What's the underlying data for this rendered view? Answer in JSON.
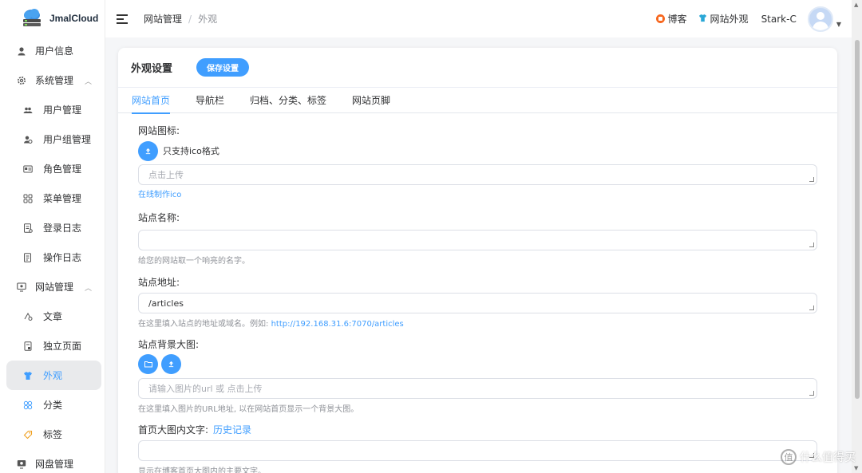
{
  "app": {
    "name": "JmalCloud"
  },
  "sidebar": {
    "items": [
      {
        "label": "用户信息",
        "level": "top",
        "icon": "user-icon"
      },
      {
        "label": "系统管理",
        "level": "top",
        "icon": "gear-icon",
        "expanded": true
      },
      {
        "label": "用户管理",
        "level": "sub",
        "icon": "users-icon"
      },
      {
        "label": "用户组管理",
        "level": "sub",
        "icon": "user-group-icon"
      },
      {
        "label": "角色管理",
        "level": "sub",
        "icon": "id-card-icon"
      },
      {
        "label": "菜单管理",
        "level": "sub",
        "icon": "grid-icon"
      },
      {
        "label": "登录日志",
        "level": "sub",
        "icon": "log-icon"
      },
      {
        "label": "操作日志",
        "level": "sub",
        "icon": "document-icon"
      },
      {
        "label": "网站管理",
        "level": "top",
        "icon": "website-icon",
        "expanded": true
      },
      {
        "label": "文章",
        "level": "sub",
        "icon": "article-icon"
      },
      {
        "label": "独立页面",
        "level": "sub",
        "icon": "page-icon"
      },
      {
        "label": "外观",
        "level": "sub",
        "icon": "shirt-icon",
        "active": true
      },
      {
        "label": "分类",
        "level": "sub",
        "icon": "category-icon"
      },
      {
        "label": "标签",
        "level": "sub",
        "icon": "tag-icon"
      },
      {
        "label": "网盘管理",
        "level": "top",
        "icon": "disk-icon"
      }
    ]
  },
  "header": {
    "breadcrumb": [
      "网站管理",
      "外观"
    ],
    "separator": "/",
    "links": [
      {
        "label": "博客",
        "icon": "blog-icon"
      },
      {
        "label": "网站外观",
        "icon": "shirt-icon"
      }
    ],
    "user": "Stark-C"
  },
  "card": {
    "title": "外观设置",
    "save_label": "保存设置",
    "tabs": [
      {
        "label": "网站首页",
        "active": true
      },
      {
        "label": "导航栏"
      },
      {
        "label": "归档、分类、标签"
      },
      {
        "label": "网站页脚"
      }
    ]
  },
  "form": {
    "favicon": {
      "label": "网站图标:",
      "upload_hint": "只支持ico格式",
      "placeholder": "点击上传",
      "link": "在线制作ico"
    },
    "site_name": {
      "label": "站点名称:",
      "value": "",
      "help": "给您的网站取一个响亮的名字。"
    },
    "site_url": {
      "label": "站点地址:",
      "value": "/articles",
      "help": "在这里填入站点的地址或域名。例如:",
      "help_link": "http://192.168.31.6:7070/articles"
    },
    "background": {
      "label": "站点背景大图:",
      "placeholder": "请输入图片的url 或 点击上传",
      "help": "在这里填入图片的URL地址, 以在网站首页显示一个背景大图。"
    },
    "banner_text": {
      "label": "首页大图内文字:",
      "history": "历史记录",
      "value": "",
      "help": "显示在博客首页大图内的主要文字。"
    }
  },
  "colors": {
    "primary": "#409eff",
    "active_bg": "#e9eaec",
    "sidebar_bg": "#ffffff"
  },
  "watermark": {
    "text": "什么值得买",
    "icon_text": "值"
  }
}
